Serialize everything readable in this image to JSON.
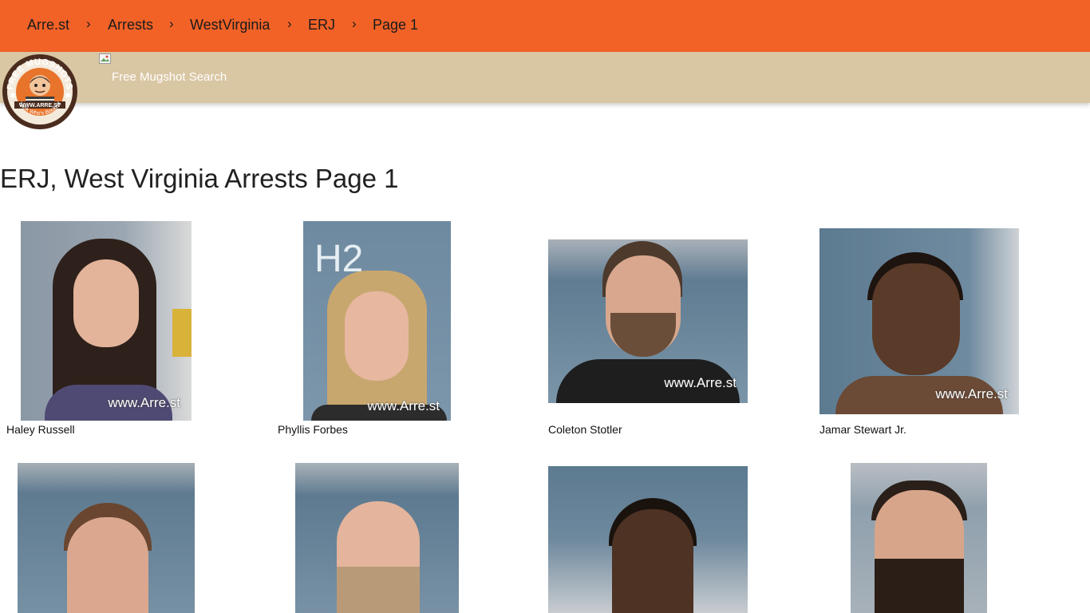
{
  "breadcrumb": {
    "items": [
      "Arre.st",
      "Arrests",
      "WestVirginia",
      "ERJ",
      "Page 1"
    ],
    "separator": "›"
  },
  "header": {
    "logo_text": [
      "FREE MUGSHOTS",
      "WWW.ARRE.ST",
      "Look Who's Booked"
    ],
    "site_link": "Free Mugshot Search"
  },
  "page": {
    "title": "ERJ, West Virginia Arrests Page 1"
  },
  "mugshots": [
    {
      "name": "Haley Russell",
      "watermark": "www.Arre.st"
    },
    {
      "name": "Phyllis Forbes",
      "watermark": "www.Arre.st"
    },
    {
      "name": "Coleton Stotler",
      "watermark": "www.Arre.st"
    },
    {
      "name": "Jamar Stewart Jr.",
      "watermark": "www.Arre.st"
    },
    {
      "name": "",
      "watermark": ""
    },
    {
      "name": "",
      "watermark": ""
    },
    {
      "name": "",
      "watermark": ""
    },
    {
      "name": "",
      "watermark": ""
    }
  ],
  "colors": {
    "topbar": "#f26227",
    "subbar": "#d9c6a3",
    "logo_ring": "#4a2c1e",
    "logo_orange": "#e8732b"
  }
}
